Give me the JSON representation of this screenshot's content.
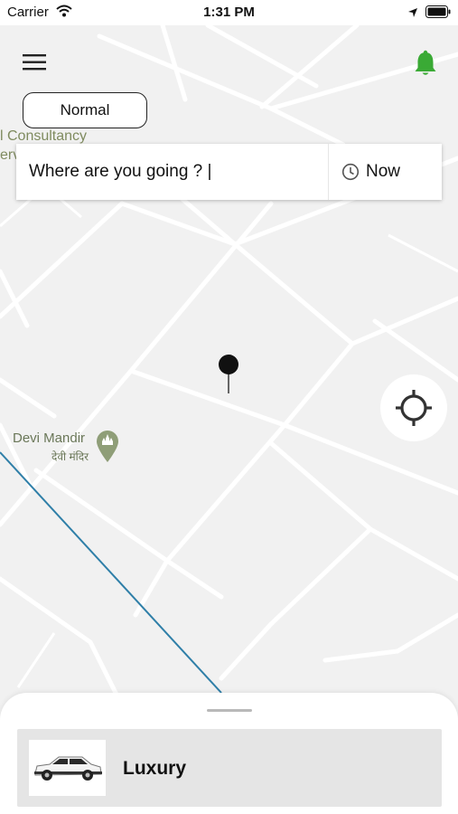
{
  "status_bar": {
    "carrier": "Carrier",
    "time": "1:31 PM",
    "icons": [
      "wifi-icon",
      "location-arrow-icon",
      "battery-icon"
    ]
  },
  "header": {
    "menu_icon": "hamburger-menu-icon",
    "notification_icon": "bell-icon",
    "notification_color": "#3aaa35"
  },
  "mode": {
    "label": "Normal"
  },
  "search": {
    "placeholder": "Where are you going ? |",
    "time_icon": "clock-icon",
    "time_label": "Now"
  },
  "map": {
    "labels": {
      "consultancy": "l Consultancy",
      "serv": "erv",
      "poi_name": "Devi Mandir",
      "poi_sub": "देवी मंदिर"
    },
    "poi_icon": "temple-pin-icon",
    "pin_icon": "map-pin-icon",
    "locate_icon": "crosshair-icon",
    "road_color": "#ffffff",
    "background_color": "#f1f1f1",
    "rail_color": "#2f7fa8"
  },
  "bottom_sheet": {
    "vehicles": [
      {
        "name": "Luxury",
        "icon": "suv-car-icon"
      }
    ]
  }
}
